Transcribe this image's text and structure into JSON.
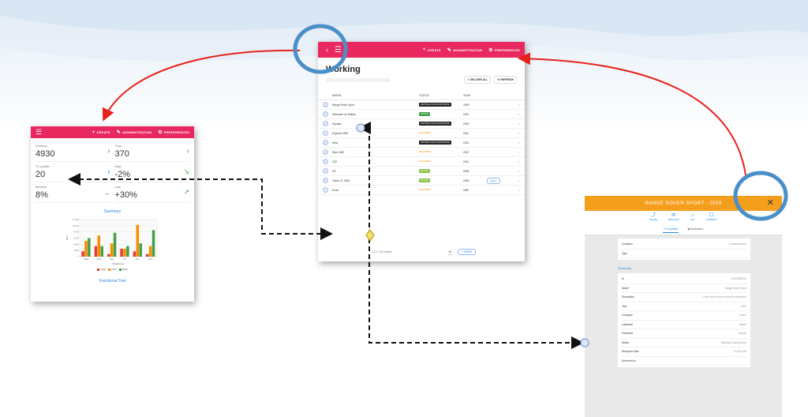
{
  "dashboard": {
    "toolbar": {
      "create": "CREATE",
      "administration": "ADMINISTRATION",
      "preferences": "PREFERENCES"
    },
    "stats": [
      {
        "label": "Working",
        "value": "4930",
        "trend": "arrow-right"
      },
      {
        "label": "Todo",
        "value": "370",
        "trend": "arrow-right"
      },
      {
        "label": "To update",
        "value": "20",
        "trend": "arrow-right"
      },
      {
        "label": "High",
        "value": "-2%",
        "trend": "trend-down"
      },
      {
        "label": "Medium",
        "value": "8%",
        "trend": "arrow-flat"
      },
      {
        "label": "Low",
        "value": "+30%",
        "trend": "trend-up"
      }
    ],
    "summary_title": "Summary",
    "functional_link": "Functional Test"
  },
  "chart_data": {
    "type": "bar",
    "title": "Summary",
    "categories": [
      "Juillet",
      "Août",
      "Sept.",
      "Oct.",
      "Nov.",
      "Déc."
    ],
    "series": [
      {
        "name": "2016",
        "color": "#e53935",
        "values": [
          2,
          4,
          1,
          3,
          2,
          1
        ]
      },
      {
        "name": "2017",
        "color": "#fb8c00",
        "values": [
          6,
          8,
          5,
          3,
          12,
          4
        ]
      },
      {
        "name": "2018",
        "color": "#43a047",
        "values": [
          7,
          4,
          9,
          4,
          5,
          10
        ]
      }
    ],
    "ylim": [
      0,
      14
    ],
    "xlabel": "Mois/Année",
    "ylabel": "Total",
    "ytick_labels": [
      "12 000",
      "10 000",
      "8 000",
      "6 000",
      "4 000",
      "2 000",
      "0"
    ],
    "grid": true,
    "legend": "bottom"
  },
  "worklist": {
    "title": "Working",
    "toolbar": {
      "create": "CREATE",
      "administration": "ADMINISTRATION",
      "preferences": "PREFERENCES"
    },
    "buttons": {
      "deliver_all": "DELIVER ALL",
      "refresh": "REFRESH"
    },
    "columns": {
      "model": "MODEL",
      "status": "STATUS",
      "year": "YEAR"
    },
    "rows": [
      {
        "model": "Range Rover Sport",
        "status": "WAITING FOR ACCEPTANCE",
        "status_style": "dark",
        "year": "2009",
        "chip": ""
      },
      {
        "model": "Defender Ice Edition",
        "status": "ACTIVE",
        "status_style": "green",
        "year": "2010",
        "chip": ""
      },
      {
        "model": "Equator",
        "status": "WAITING FOR ACCEPTANCE",
        "status_style": "dark",
        "year": "2009",
        "chip": ""
      },
      {
        "model": "Express 1500",
        "status": "DELIVERED",
        "status_style": "orange",
        "year": "2011",
        "chip": ""
      },
      {
        "model": "Hilux",
        "status": "WAITING FOR ACCEPTANCE",
        "status_style": "dark",
        "year": "2012",
        "chip": ""
      },
      {
        "model": "Ram 1500",
        "status": "DELIVERED",
        "status_style": "orange",
        "year": "2012",
        "chip": ""
      },
      {
        "model": "C30",
        "status": "DELIVERED",
        "status_style": "orange",
        "year": "2010",
        "chip": ""
      },
      {
        "model": "CR",
        "status": "ACTIVE",
        "status_style": "greenlight",
        "year": "2008",
        "chip": ""
      },
      {
        "model": "Yukon XL 2500",
        "status": "ACTIVE",
        "status_style": "greenlight",
        "year": "2009",
        "chip": "Deliver"
      },
      {
        "model": "Excel",
        "status": "DELIVERED",
        "status_style": "orange",
        "year": "1987",
        "chip": ""
      }
    ],
    "pager": {
      "count": "1-10 / 100 entries",
      "page_size": "10",
      "more": "MORE"
    }
  },
  "detail": {
    "title": "RANGE ROVER SPORT - 2009",
    "tabs": [
      "SHARE",
      "MESSAGE",
      "TAG",
      "COMMENT"
    ],
    "subtabs": [
      "Properties",
      "Illustration"
    ],
    "top_fields": [
      {
        "key": "Container",
        "value": "ContainerName"
      },
      {
        "key": "Type",
        "value": ""
      }
    ],
    "summary_title": "Summary",
    "summary_fields": [
      {
        "key": "Id",
        "value": "A7BC98S912"
      },
      {
        "key": "Model",
        "value": "Range Rover Sport"
      },
      {
        "key": "Description",
        "value": "Lorem ipsum dolor sit amet consectetur"
      },
      {
        "key": "Year",
        "value": "2009"
      },
      {
        "key": "Company",
        "value": "Rover"
      },
      {
        "key": "Lastname",
        "value": "Martin"
      },
      {
        "key": "Firstname",
        "value": "Sophie"
      },
      {
        "key": "Status",
        "value": "Waiting for acceptance"
      },
      {
        "key": "Reception date",
        "value": "11-08-2018"
      },
      {
        "key": "Delivered on",
        "value": ""
      }
    ]
  }
}
